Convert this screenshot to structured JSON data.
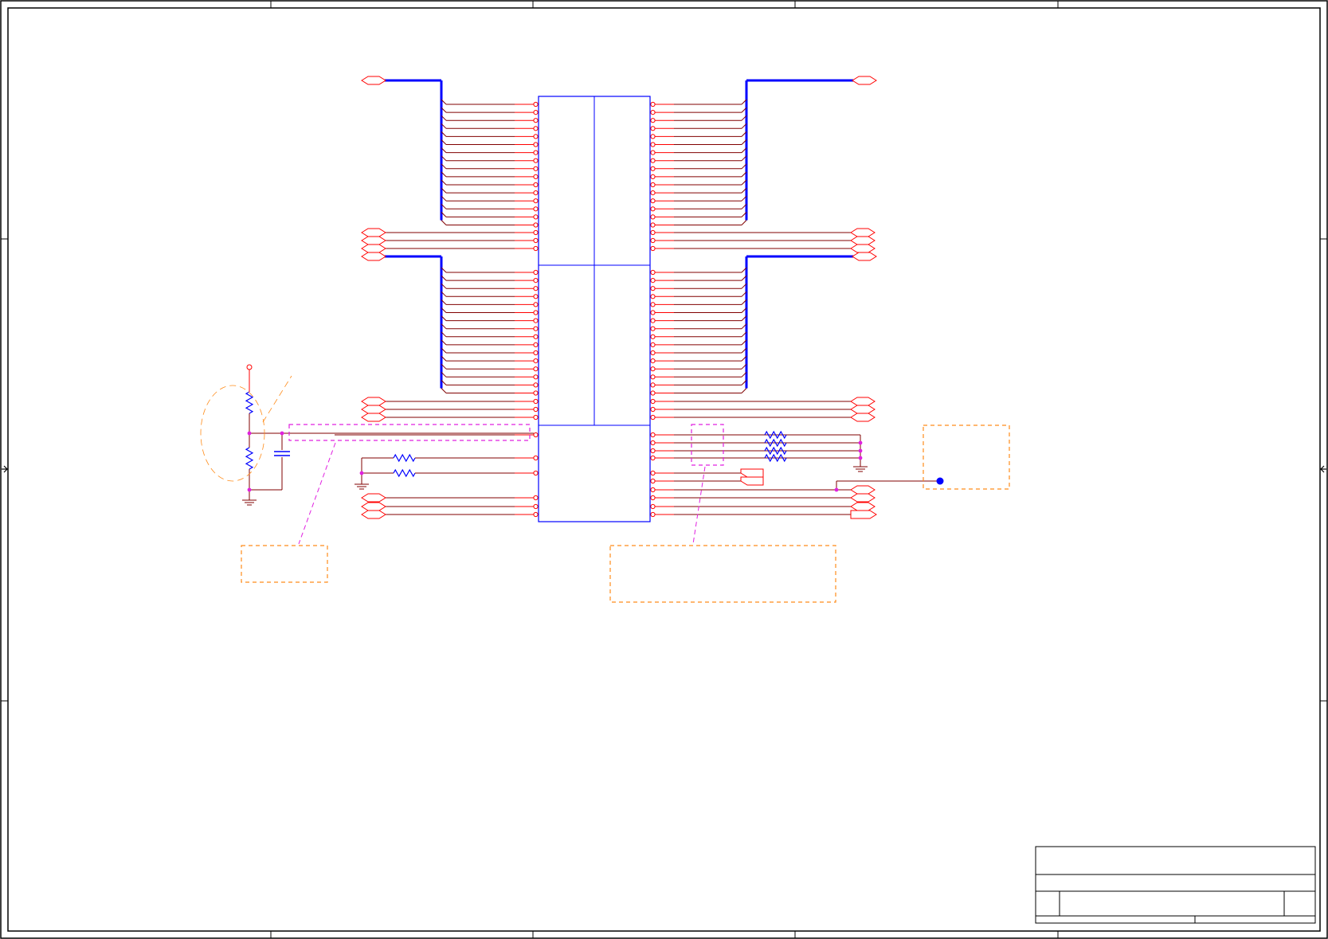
{
  "document": {
    "kind": "schematic-sheet",
    "visible_text": []
  },
  "colors": {
    "frame": "#000000",
    "pin": "#ff0000",
    "wire": "#800000",
    "bus": "#0000ff",
    "component_body": "#0000ff",
    "junction": "#e020e0",
    "note_box": "#ff8c1a",
    "highlight_box": "#e020e0",
    "net_label": "#ff0000",
    "test_point": "#0000ff"
  },
  "icons": {
    "resistor": "resistor-icon",
    "capacitor": "capacitor-icon",
    "ground": "ground-icon",
    "power_port": "power-port-icon",
    "off_sheet_port": "port-icon"
  },
  "title_block": {
    "fields": []
  }
}
